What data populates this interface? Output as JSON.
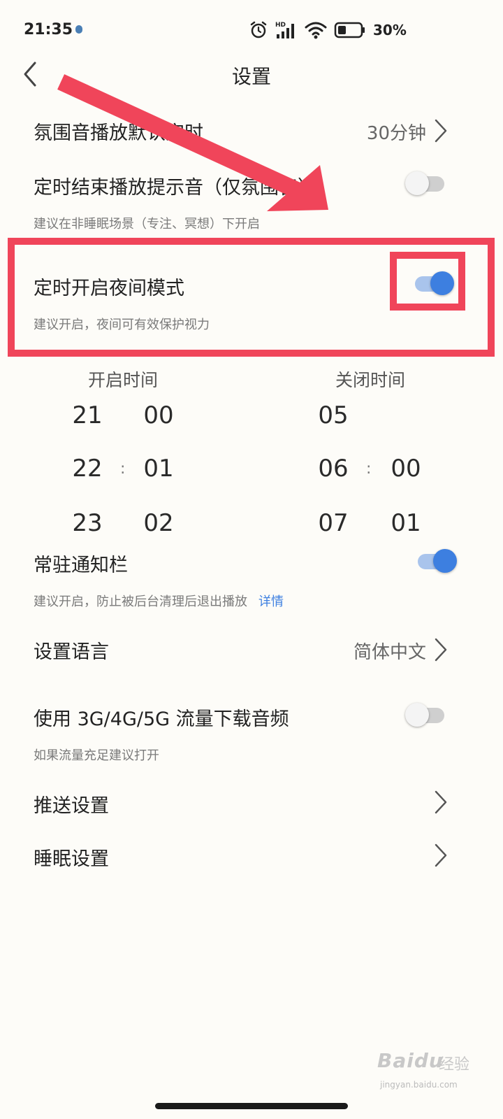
{
  "status_bar": {
    "time": "21:35",
    "network_badge": "HD",
    "battery": "30%"
  },
  "header": {
    "title": "设置"
  },
  "settings": {
    "ambient_timer": {
      "title": "氛围音播放默认定时",
      "value": "30分钟"
    },
    "timer_end_sound": {
      "title": "定时结束播放提示音（仅氛围音）",
      "subtitle": "建议在非睡眠场景（专注、冥想）下开启",
      "enabled": false
    },
    "night_mode": {
      "title": "定时开启夜间模式",
      "subtitle": "建议开启，夜间可有效保护视力",
      "enabled": true
    },
    "time_picker": {
      "start_label": "开启时间",
      "end_label": "关闭时间",
      "start_hours": [
        "21",
        "22",
        "23"
      ],
      "start_minutes": [
        "00",
        "01",
        "02"
      ],
      "end_hours": [
        "05",
        "06",
        "07"
      ],
      "end_minutes": [
        "",
        "00",
        "01"
      ],
      "separator": ":"
    },
    "notification_bar": {
      "title": "常驻通知栏",
      "subtitle": "建议开启，防止被后台清理后退出播放",
      "detail_link": "详情",
      "enabled": true
    },
    "language": {
      "title": "设置语言",
      "value": "简体中文"
    },
    "mobile_data_download": {
      "title": "使用 3G/4G/5G 流量下载音频",
      "subtitle": "如果流量充足建议打开",
      "enabled": false
    },
    "push": {
      "title": "推送设置"
    },
    "sleep": {
      "title": "睡眠设置"
    }
  },
  "watermark": {
    "logo": "Baidu",
    "cn": "经验",
    "url": "jingyan.baidu.com"
  },
  "colors": {
    "accent": "#3d7fe0",
    "annotation": "#f0455a",
    "background": "#fdfcf8"
  }
}
